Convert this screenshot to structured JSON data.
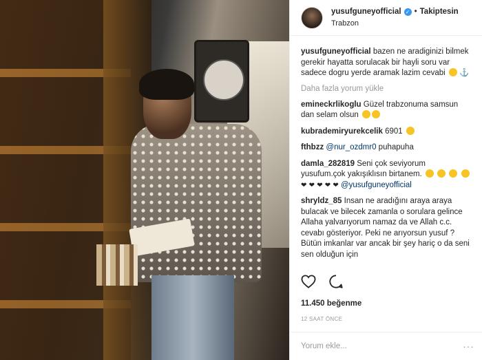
{
  "post": {
    "username": "yusufguneyofficial",
    "follow_label": "Takiptesin",
    "location": "Trabzon",
    "caption": "bazen ne aradiginizi bilmek gerekir hayatta sorulacak bir hayli soru var sadece dogru yerde aramak lazim cevabi",
    "load_more": "Daha fazla yorum yükle",
    "likes": "11.450 beğenme",
    "time": "12 SAAT ÖNCE",
    "comment_placeholder": "Yorum ekle...",
    "more_menu": "···"
  },
  "comments": [
    {
      "user": "emineckrlikoglu",
      "text": "Güzel trabzonuma samsun dan selam olsun"
    },
    {
      "user": "kubrademiryurekcelik",
      "text": "6901"
    },
    {
      "user": "fthbzz",
      "mention": "@nur_ozdmr0",
      "text": "puhapuha"
    },
    {
      "user": "damla_282819",
      "text": "Seni çok seviyorum yusufum.çok yakışıklısın birtanem.",
      "mention": "@yusufguneyofficial"
    },
    {
      "user": "shryldz_85",
      "text": "Insan ne aradığını araya araya bulacak ve bilecek zamanla o sorulara gelince Allaha yalvarıyorum namaz da ve Allah c.c. cevabı gösteriyor. Peki ne arıyorsun yusuf ? Bütün imkanlar var ancak bir şey hariç o da seni sen olduğun için"
    }
  ],
  "icons": {
    "verified": "verified-badge-icon",
    "like": "heart-icon",
    "comment": "comment-bubble-icon"
  },
  "colors": {
    "verified": "#3897f0",
    "mention": "#003569",
    "muted": "#999999"
  }
}
